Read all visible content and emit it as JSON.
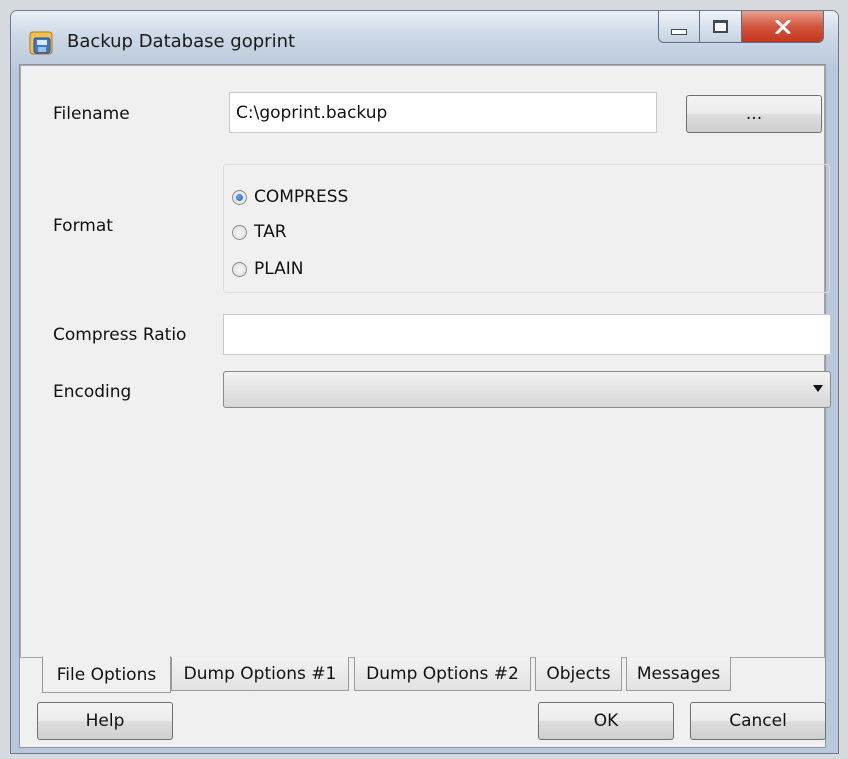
{
  "window": {
    "title": "Backup Database goprint",
    "controls": {
      "minimize": "minimize-icon",
      "maximize": "maximize-icon",
      "close": "close-icon"
    }
  },
  "form": {
    "filename_label": "Filename",
    "filename_value": "C:\\goprint.backup",
    "browse_label": "...",
    "format_label": "Format",
    "format_options": [
      {
        "label": "COMPRESS",
        "checked": true
      },
      {
        "label": "TAR",
        "checked": false
      },
      {
        "label": "PLAIN",
        "checked": false
      }
    ],
    "compress_ratio_label": "Compress Ratio",
    "compress_ratio_value": "",
    "encoding_label": "Encoding",
    "encoding_value": ""
  },
  "tabs": [
    {
      "label": "File Options",
      "active": true
    },
    {
      "label": "Dump Options #1",
      "active": false
    },
    {
      "label": "Dump Options #2",
      "active": false
    },
    {
      "label": "Objects",
      "active": false
    },
    {
      "label": "Messages",
      "active": false
    }
  ],
  "buttons": {
    "help": "Help",
    "ok": "OK",
    "cancel": "Cancel"
  }
}
